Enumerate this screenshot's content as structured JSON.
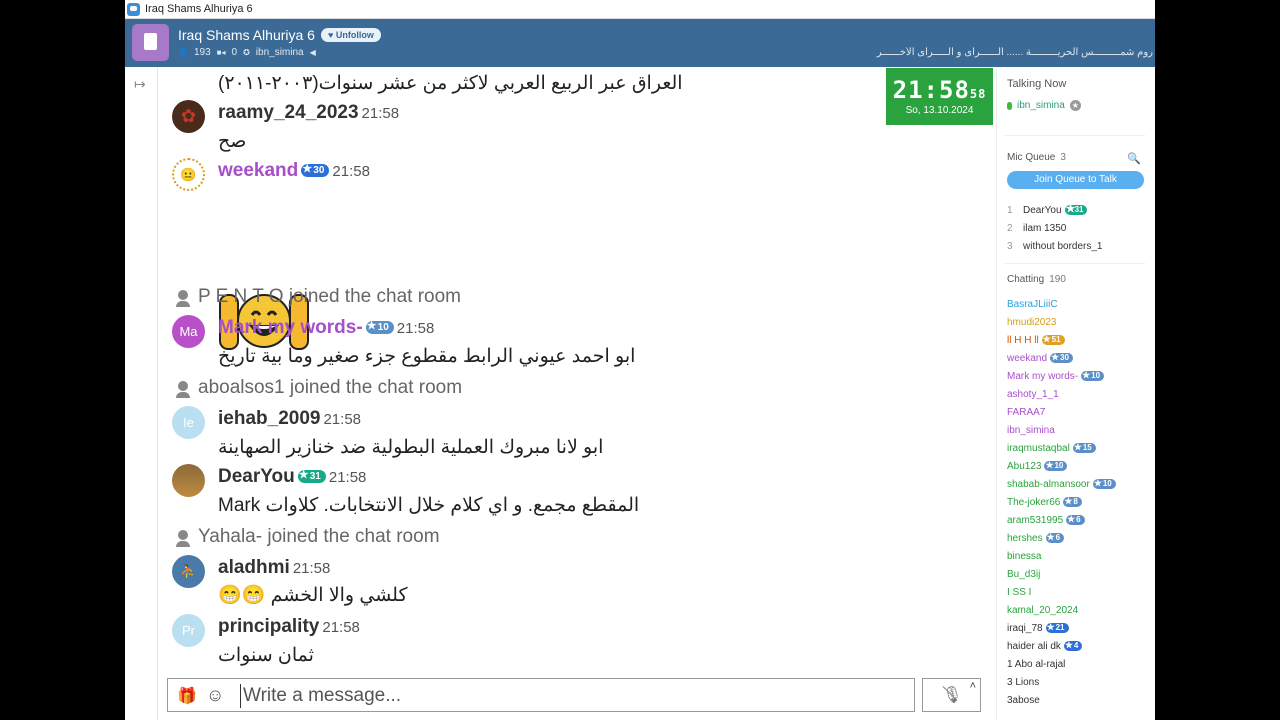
{
  "window": {
    "title": "Iraq Shams Alhuriya 6"
  },
  "room": {
    "name": "Iraq Shams Alhuriya 6",
    "unfollow_label": "Unfollow",
    "users": "193",
    "cams": "0",
    "host": "ibn_simina",
    "marquee": "روم شمـــــــــس الحريـــــــــة ...... الــــــرأى و الـــــرأى الأخــــــر"
  },
  "clock": {
    "time": "21:58",
    "seconds": "58",
    "date": "So, 13.10.2024"
  },
  "messages": [
    {
      "text": "العراق عبر الربيع العربي لاكثر من عشر سنوات(٢٠٠٣-٢٠١١)"
    },
    {
      "user": "raamy_24_2023",
      "time": "21:58",
      "text": "صح"
    },
    {
      "user": "weekand",
      "badge": "30",
      "time": "21:58"
    },
    {
      "system": "P E N T O joined the chat room"
    },
    {
      "user": "Mark my words-",
      "initials": "Ma",
      "badge": "10",
      "time": "21:58",
      "text": "ابو احمد عيوني الرابط مقطوع جزء صغير وما بية تاريخ"
    },
    {
      "system": "aboalsos1 joined the chat room"
    },
    {
      "user": "iehab_2009",
      "initials": "Ie",
      "time": "21:58",
      "text": "ابو لانا مبروك العملية البطولية ضد خنازير الصهاينة"
    },
    {
      "user": "DearYou",
      "badge": "31",
      "time": "21:58",
      "text": "المقطع مجمع.   و اي كلام خلال الانتخابات.   كلاوات Mark"
    },
    {
      "system": "Yahala- joined the chat room"
    },
    {
      "user": "aladhmi",
      "time": "21:58",
      "text": "كلشي والا الخشم"
    },
    {
      "user": "principality",
      "initials": "Pr",
      "time": "21:58",
      "text": "ثمان سنوات"
    }
  ],
  "composer": {
    "placeholder": "Write a message..."
  },
  "sidebar": {
    "talking_now": "Talking Now",
    "talking_user": "ibn_simina",
    "mic_queue": "Mic Queue",
    "mic_queue_count": "3",
    "join_queue": "Join Queue to Talk",
    "queue": [
      {
        "n": "1",
        "name": "DearYou",
        "badge": "31"
      },
      {
        "n": "2",
        "name": "ilam 1350"
      },
      {
        "n": "3",
        "name": "without borders_1"
      }
    ],
    "chatting": "Chatting",
    "chatting_count": "190",
    "users": [
      {
        "name": "BasraJLiiiC",
        "color": "#2a9fd6"
      },
      {
        "name": "hmudi2023",
        "color": "#d4a017"
      },
      {
        "name": "ll H H ll",
        "color": "#d35400",
        "badge": "51"
      },
      {
        "name": "weekand",
        "color": "#a64fc9",
        "badge": "30"
      },
      {
        "name": "Mark my words-",
        "color": "#a64fc9",
        "badge": "10"
      },
      {
        "name": "ashoty_1_1",
        "color": "#a64fc9"
      },
      {
        "name": "FARAA7",
        "color": "#a64fc9"
      },
      {
        "name": "ibn_simina",
        "color": "#a64fc9"
      },
      {
        "name": "iraqmustaqbal",
        "color": "#2aa33e",
        "badge": "15"
      },
      {
        "name": "Abu123",
        "color": "#2aa33e",
        "badge": "10"
      },
      {
        "name": "shabab-almansoor",
        "color": "#2aa33e",
        "badge": "10"
      },
      {
        "name": "The-joker66",
        "color": "#2aa33e",
        "badge": "8"
      },
      {
        "name": "aram531995",
        "color": "#2aa33e",
        "badge": "6"
      },
      {
        "name": "hershes",
        "color": "#2aa33e",
        "badge": "6"
      },
      {
        "name": "binessa",
        "color": "#2aa33e"
      },
      {
        "name": "Bu_d3ij",
        "color": "#2aa33e"
      },
      {
        "name": "I SS I",
        "color": "#2aa33e"
      },
      {
        "name": "kamal_20_2024",
        "color": "#2aa33e"
      },
      {
        "name": "iraqi_78",
        "color": "#333",
        "badge": "21"
      },
      {
        "name": "haider ali dk",
        "color": "#333",
        "badge": "4"
      },
      {
        "name": "1 Abo al-rajal",
        "color": "#333"
      },
      {
        "name": "3 Lions",
        "color": "#333"
      },
      {
        "name": "3abose",
        "color": "#333"
      }
    ]
  }
}
